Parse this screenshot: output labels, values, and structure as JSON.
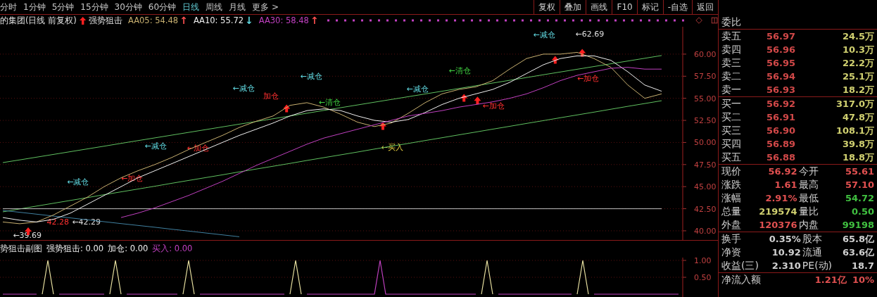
{
  "menu": {
    "items": [
      {
        "label": "分时",
        "selected": false
      },
      {
        "label": "1分钟",
        "selected": false
      },
      {
        "label": "5分钟",
        "selected": false
      },
      {
        "label": "15分钟",
        "selected": false
      },
      {
        "label": "30分钟",
        "selected": false
      },
      {
        "label": "60分钟",
        "selected": false
      },
      {
        "label": "日线",
        "selected": true
      },
      {
        "label": "周线",
        "selected": false
      },
      {
        "label": "月线",
        "selected": false
      },
      {
        "label": "更多 >",
        "selected": false
      }
    ],
    "buttons": [
      "复权",
      "叠加",
      "画线",
      "F10",
      "标记",
      "-自选",
      "返回"
    ]
  },
  "legend": {
    "title": "的集团(日线 前复权)",
    "indicator": "强势狙击",
    "items": [
      {
        "label": "AA05: 54.48",
        "color": "#c8b070",
        "arrow": {
          "text": "↑",
          "color": "#ff5050"
        }
      },
      {
        "label": "AA10: 55.72",
        "color": "#f0f0f0",
        "arrow": {
          "text": "↓",
          "color": "#60d8e0"
        }
      },
      {
        "label": "AA30: 58.48",
        "color": "#c040c0",
        "arrow": {
          "text": "↑",
          "color": "#ff5050"
        }
      }
    ]
  },
  "main_chart": {
    "chart_data": {
      "type": "line",
      "grid": true,
      "ylim": [
        38.96,
        63.1
      ],
      "yticks": [
        {
          "value": 40,
          "label": "40.00"
        },
        {
          "value": 42.5,
          "label": "42.50"
        },
        {
          "value": 45,
          "label": "45.00"
        },
        {
          "value": 47.5,
          "label": "47.50"
        },
        {
          "value": 50,
          "label": "50.00"
        },
        {
          "value": 52.5,
          "label": "52.50"
        },
        {
          "value": 55,
          "label": "55.00"
        },
        {
          "value": 57.5,
          "label": "57.50"
        },
        {
          "value": 60,
          "label": "60.00"
        }
      ],
      "series": [
        {
          "color": "#60c060",
          "values": [
            47.72,
            48.03,
            48.34,
            48.65,
            48.96,
            49.27,
            49.58,
            49.9,
            50.21,
            50.52,
            50.83,
            51.14,
            51.45,
            51.76,
            52.07,
            52.38,
            52.69,
            53,
            53.31,
            53.63,
            53.94,
            54.25,
            54.56,
            54.87,
            55.18,
            55.49,
            55.8,
            56.11,
            56.42,
            56.73,
            57.04,
            57.35,
            57.67,
            57.98,
            58.29,
            58.6,
            58.91,
            59.22,
            59.53,
            59.84
          ]
        },
        {
          "color": "#60c060",
          "values": [
            42.15,
            42.47,
            42.8,
            43.12,
            43.44,
            43.76,
            44.09,
            44.41,
            44.73,
            45.05,
            45.38,
            45.7,
            46.02,
            46.34,
            46.67,
            46.99,
            47.31,
            47.63,
            47.96,
            48.28,
            48.6,
            48.92,
            49.25,
            49.57,
            49.89,
            50.22,
            50.54,
            50.86,
            51.18,
            51.51,
            51.83,
            52.15,
            52.47,
            52.8,
            53.12,
            53.44,
            53.76,
            54.09,
            54.41,
            54.73
          ]
        },
        {
          "color": "#4080a0",
          "values": [
            42.31,
            42.1,
            41.88,
            41.67,
            41.46,
            41.25,
            41.03,
            40.82,
            40.61,
            40.4,
            40.18,
            39.97,
            39.76,
            39.54,
            39.33,
            null,
            null,
            null,
            null,
            null,
            null,
            null,
            null,
            null,
            null,
            null,
            null,
            null,
            null,
            null,
            null,
            null,
            null,
            null,
            null,
            null,
            null,
            null,
            null,
            null
          ]
        },
        {
          "color": "#c0c0c0",
          "values": [
            42.5,
            42.5,
            42.5,
            42.5,
            42.5,
            42.5,
            42.5,
            42.5,
            42.5,
            42.5,
            42.5,
            42.5,
            42.5,
            42.5,
            42.5,
            42.5,
            42.5,
            42.5,
            42.5,
            42.5,
            42.5,
            42.5,
            42.5,
            42.5,
            42.5,
            42.5,
            42.5,
            42.5,
            42.5,
            42.5,
            42.5,
            42.5,
            42.5,
            42.5,
            42.5,
            42.5,
            42.5,
            42.5,
            42.5,
            42.5
          ]
        },
        {
          "color": "#c8b070",
          "values": [
            41,
            40.8,
            41,
            41.8,
            42.8,
            43.8,
            45,
            46,
            46.8,
            47.5,
            48.3,
            49.2,
            50,
            50.8,
            51.7,
            52.4,
            53,
            54.2,
            54.5,
            54,
            53.2,
            52.3,
            51.8,
            52.2,
            53.3,
            54.5,
            55.5,
            56,
            56.3,
            57,
            58.3,
            59.5,
            60,
            60,
            60.2,
            59.5,
            58.5,
            56.5,
            55,
            55.5
          ]
        },
        {
          "color": "#f0f0f0",
          "values": [
            41.5,
            41.2,
            41,
            41.3,
            42,
            43,
            44,
            45,
            46,
            46.8,
            47.6,
            48.4,
            49.2,
            50,
            50.8,
            51.5,
            52.2,
            53,
            53.6,
            53.8,
            53.6,
            53,
            52.5,
            52.3,
            52.6,
            53.4,
            54.3,
            55,
            55.5,
            56,
            56.8,
            57.8,
            58.8,
            59.5,
            59.8,
            59.8,
            59.3,
            58,
            56.5,
            55.8
          ]
        },
        {
          "color": "#c040c0",
          "values": [
            null,
            null,
            null,
            null,
            null,
            null,
            null,
            41.5,
            42,
            42.6,
            43.3,
            44,
            44.8,
            45.6,
            46.5,
            47.4,
            48.2,
            49,
            49.8,
            50.5,
            51,
            51.5,
            52,
            52.5,
            53,
            53.3,
            53.6,
            54,
            54.3,
            54.6,
            55,
            55.5,
            56.2,
            57,
            57.6,
            58,
            58.4,
            58.5,
            58.3,
            58.3
          ]
        }
      ]
    },
    "signals": [
      {
        "kind": "price",
        "text": "←39.69"
      },
      {
        "kind": "add",
        "text": "42.28"
      },
      {
        "kind": "price",
        "text": "←42.29"
      },
      {
        "kind": "reduce",
        "text": "←减仓"
      },
      {
        "kind": "add",
        "text": "←加仓"
      },
      {
        "kind": "reduce",
        "text": "←减仓"
      },
      {
        "kind": "add",
        "text": "←加仓"
      },
      {
        "kind": "reduce",
        "text": "←减仓"
      },
      {
        "kind": "reduce",
        "text": "←减仓"
      },
      {
        "kind": "add",
        "text": "加仓"
      },
      {
        "kind": "clear",
        "text": "←清仓"
      },
      {
        "kind": "buy",
        "text": "←买入"
      },
      {
        "kind": "reduce",
        "text": "←减仓"
      },
      {
        "kind": "clear",
        "text": "←清仓"
      },
      {
        "kind": "add",
        "text": "←加仓"
      },
      {
        "kind": "reduce",
        "text": "←减仓"
      },
      {
        "kind": "price",
        "text": "←62.69"
      },
      {
        "kind": "add",
        "text": "←加仓"
      }
    ]
  },
  "sub_chart": {
    "title": "势狙击副图",
    "items": [
      {
        "label": "强势狙击: 0.00",
        "color": "#f0f0f0"
      },
      {
        "label": "加仓: 0.00",
        "color": "#f0f0f0"
      },
      {
        "label": "买入: 0.00",
        "color": "#c040c0"
      }
    ],
    "chart_data": {
      "type": "line",
      "ylim": [
        -0.0833,
        1.0833
      ],
      "yticks": [
        {
          "value": 0.5,
          "label": "0.50"
        },
        {
          "value": 1,
          "label": "1.00"
        }
      ],
      "series": [
        {
          "color": "#c040c0",
          "values": [
            0,
            0,
            0,
            0,
            0,
            0,
            0,
            null,
            null,
            null,
            0,
            0,
            0,
            0,
            0,
            0,
            0,
            0,
            0,
            null,
            null,
            null,
            0,
            0,
            0,
            0,
            0,
            0,
            0,
            0,
            0,
            0,
            null,
            null,
            null,
            0,
            0,
            0,
            0,
            0,
            0,
            0,
            0,
            0,
            0,
            0,
            0,
            0,
            0,
            0,
            0,
            null,
            null,
            null,
            0,
            0,
            0,
            0,
            0,
            0,
            0,
            0,
            0,
            0,
            0,
            0,
            0,
            1,
            0,
            0,
            0,
            0,
            0,
            0,
            0,
            0,
            0,
            0,
            0,
            0,
            0,
            0,
            0,
            0,
            0,
            null,
            null,
            null,
            0,
            0,
            0,
            0,
            0,
            0,
            0,
            0,
            0,
            0,
            0,
            0,
            0,
            0,
            null,
            null,
            null,
            0,
            0,
            0,
            0,
            0,
            0,
            0,
            0,
            0,
            0,
            0,
            0,
            0,
            0,
            0,
            0
          ]
        },
        {
          "color": "#e8e0a0",
          "values": [
            null,
            null,
            null,
            null,
            null,
            null,
            null,
            0,
            1,
            0,
            null,
            null,
            null,
            null,
            null,
            null,
            null,
            null,
            null,
            0,
            1,
            0,
            null,
            null,
            null,
            null,
            null,
            null,
            null,
            null,
            null,
            null,
            0,
            1,
            0,
            null,
            null,
            null,
            null,
            null,
            null,
            null,
            null,
            null,
            null,
            null,
            null,
            null,
            null,
            null,
            null,
            0,
            1,
            0,
            null,
            null,
            null,
            null,
            null,
            null,
            null,
            null,
            null,
            null,
            null,
            null,
            null,
            null,
            null,
            null,
            null,
            null,
            null,
            null,
            null,
            null,
            null,
            null,
            null,
            null,
            null,
            null,
            null,
            null,
            null,
            0,
            1,
            0,
            null,
            null,
            null,
            null,
            null,
            null,
            null,
            null,
            null,
            null,
            null,
            null,
            null,
            null,
            0,
            1,
            0,
            null,
            null,
            null,
            null,
            null,
            null,
            null,
            null,
            null,
            null,
            null,
            null,
            null,
            null,
            null,
            null
          ]
        }
      ]
    }
  },
  "quote": {
    "ratio_label": "委比",
    "asks": [
      {
        "label": "卖五",
        "price": "56.97",
        "volume": "24.5万"
      },
      {
        "label": "卖四",
        "price": "56.96",
        "volume": "10.3万"
      },
      {
        "label": "卖三",
        "price": "56.95",
        "volume": "22.2万"
      },
      {
        "label": "卖二",
        "price": "56.94",
        "volume": "25.1万"
      },
      {
        "label": "卖一",
        "price": "56.93",
        "volume": "18.2万"
      }
    ],
    "bids": [
      {
        "label": "买一",
        "price": "56.92",
        "volume": "317.0万"
      },
      {
        "label": "买二",
        "price": "56.91",
        "volume": "47.8万"
      },
      {
        "label": "买三",
        "price": "56.90",
        "volume": "108.1万"
      },
      {
        "label": "买四",
        "price": "56.89",
        "volume": "39.8万"
      },
      {
        "label": "买五",
        "price": "56.88",
        "volume": "18.8万"
      }
    ],
    "stats": [
      {
        "label": "现价",
        "value": "56.92",
        "color": "#e05050"
      },
      {
        "label": "今开",
        "value": "55.61",
        "color": "#e05050"
      },
      {
        "label": "涨跌",
        "value": "1.61",
        "color": "#e05050"
      },
      {
        "label": "最高",
        "value": "57.10",
        "color": "#e05050"
      },
      {
        "label": "涨幅",
        "value": "2.91%",
        "color": "#e05050"
      },
      {
        "label": "最低",
        "value": "54.72",
        "color": "#40c040"
      },
      {
        "label": "总量",
        "value": "219574",
        "color": "#d0d070"
      },
      {
        "label": "量比",
        "value": "0.50",
        "color": "#40c040"
      },
      {
        "label": "外盘",
        "value": "120376",
        "color": "#e05050"
      },
      {
        "label": "内盘",
        "value": "99198",
        "color": "#40c040"
      }
    ],
    "fundamentals": [
      {
        "label": "换手",
        "value": "0.35%"
      },
      {
        "label": "股本",
        "value": "65.8亿"
      },
      {
        "label": "净资",
        "value": "10.92"
      },
      {
        "label": "流通",
        "value": "63.6亿"
      },
      {
        "label": "收益(三)",
        "value": "2.310"
      },
      {
        "label": "PE(动)",
        "value": "18.7"
      }
    ],
    "net_flow": {
      "label": "净流入额",
      "value": "1.21亿",
      "percent": "10%"
    }
  }
}
